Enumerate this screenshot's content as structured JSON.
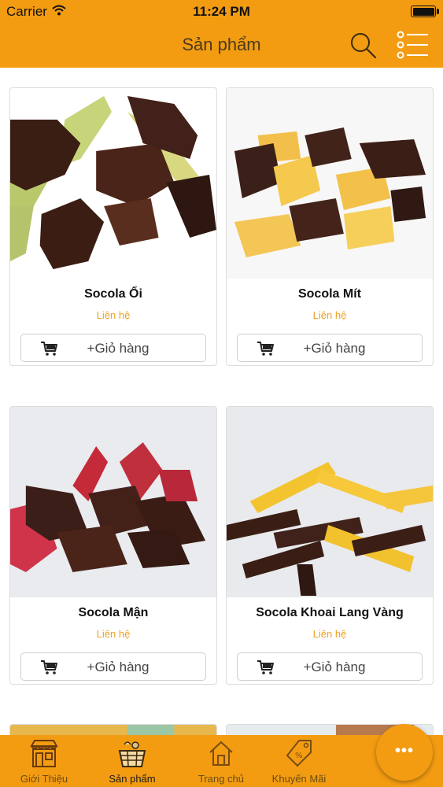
{
  "status_bar": {
    "carrier": "Carrier",
    "time": "11:24 PM",
    "battery_level": 1.0
  },
  "nav": {
    "title": "Sản phẩm",
    "search_icon": "search-icon",
    "menu_icon": "list-menu-icon"
  },
  "products": [
    {
      "name": "Socola Ổi",
      "price": "Liên hệ",
      "cart_label": "+Giỏ hàng"
    },
    {
      "name": "Socola Mít",
      "price": "Liên hệ",
      "cart_label": "+Giỏ hàng"
    },
    {
      "name": "Socola Mận",
      "price": "Liên hệ",
      "cart_label": "+Giỏ hàng"
    },
    {
      "name": "Socola Khoai Lang Vàng",
      "price": "Liên hệ",
      "cart_label": "+Giỏ hàng"
    }
  ],
  "tabbar": {
    "tabs": [
      {
        "label": "Giới Thiệu",
        "icon": "storefront-icon"
      },
      {
        "label": "Sản phẩm",
        "icon": "basket-icon",
        "active": true
      },
      {
        "label": "Trang chủ",
        "icon": "home-icon"
      },
      {
        "label": "Khuyến Mãi",
        "icon": "price-tag-icon"
      }
    ],
    "more_button": "more-dots-icon"
  },
  "colors": {
    "accent": "#f39c12",
    "price": "#f0a020"
  }
}
